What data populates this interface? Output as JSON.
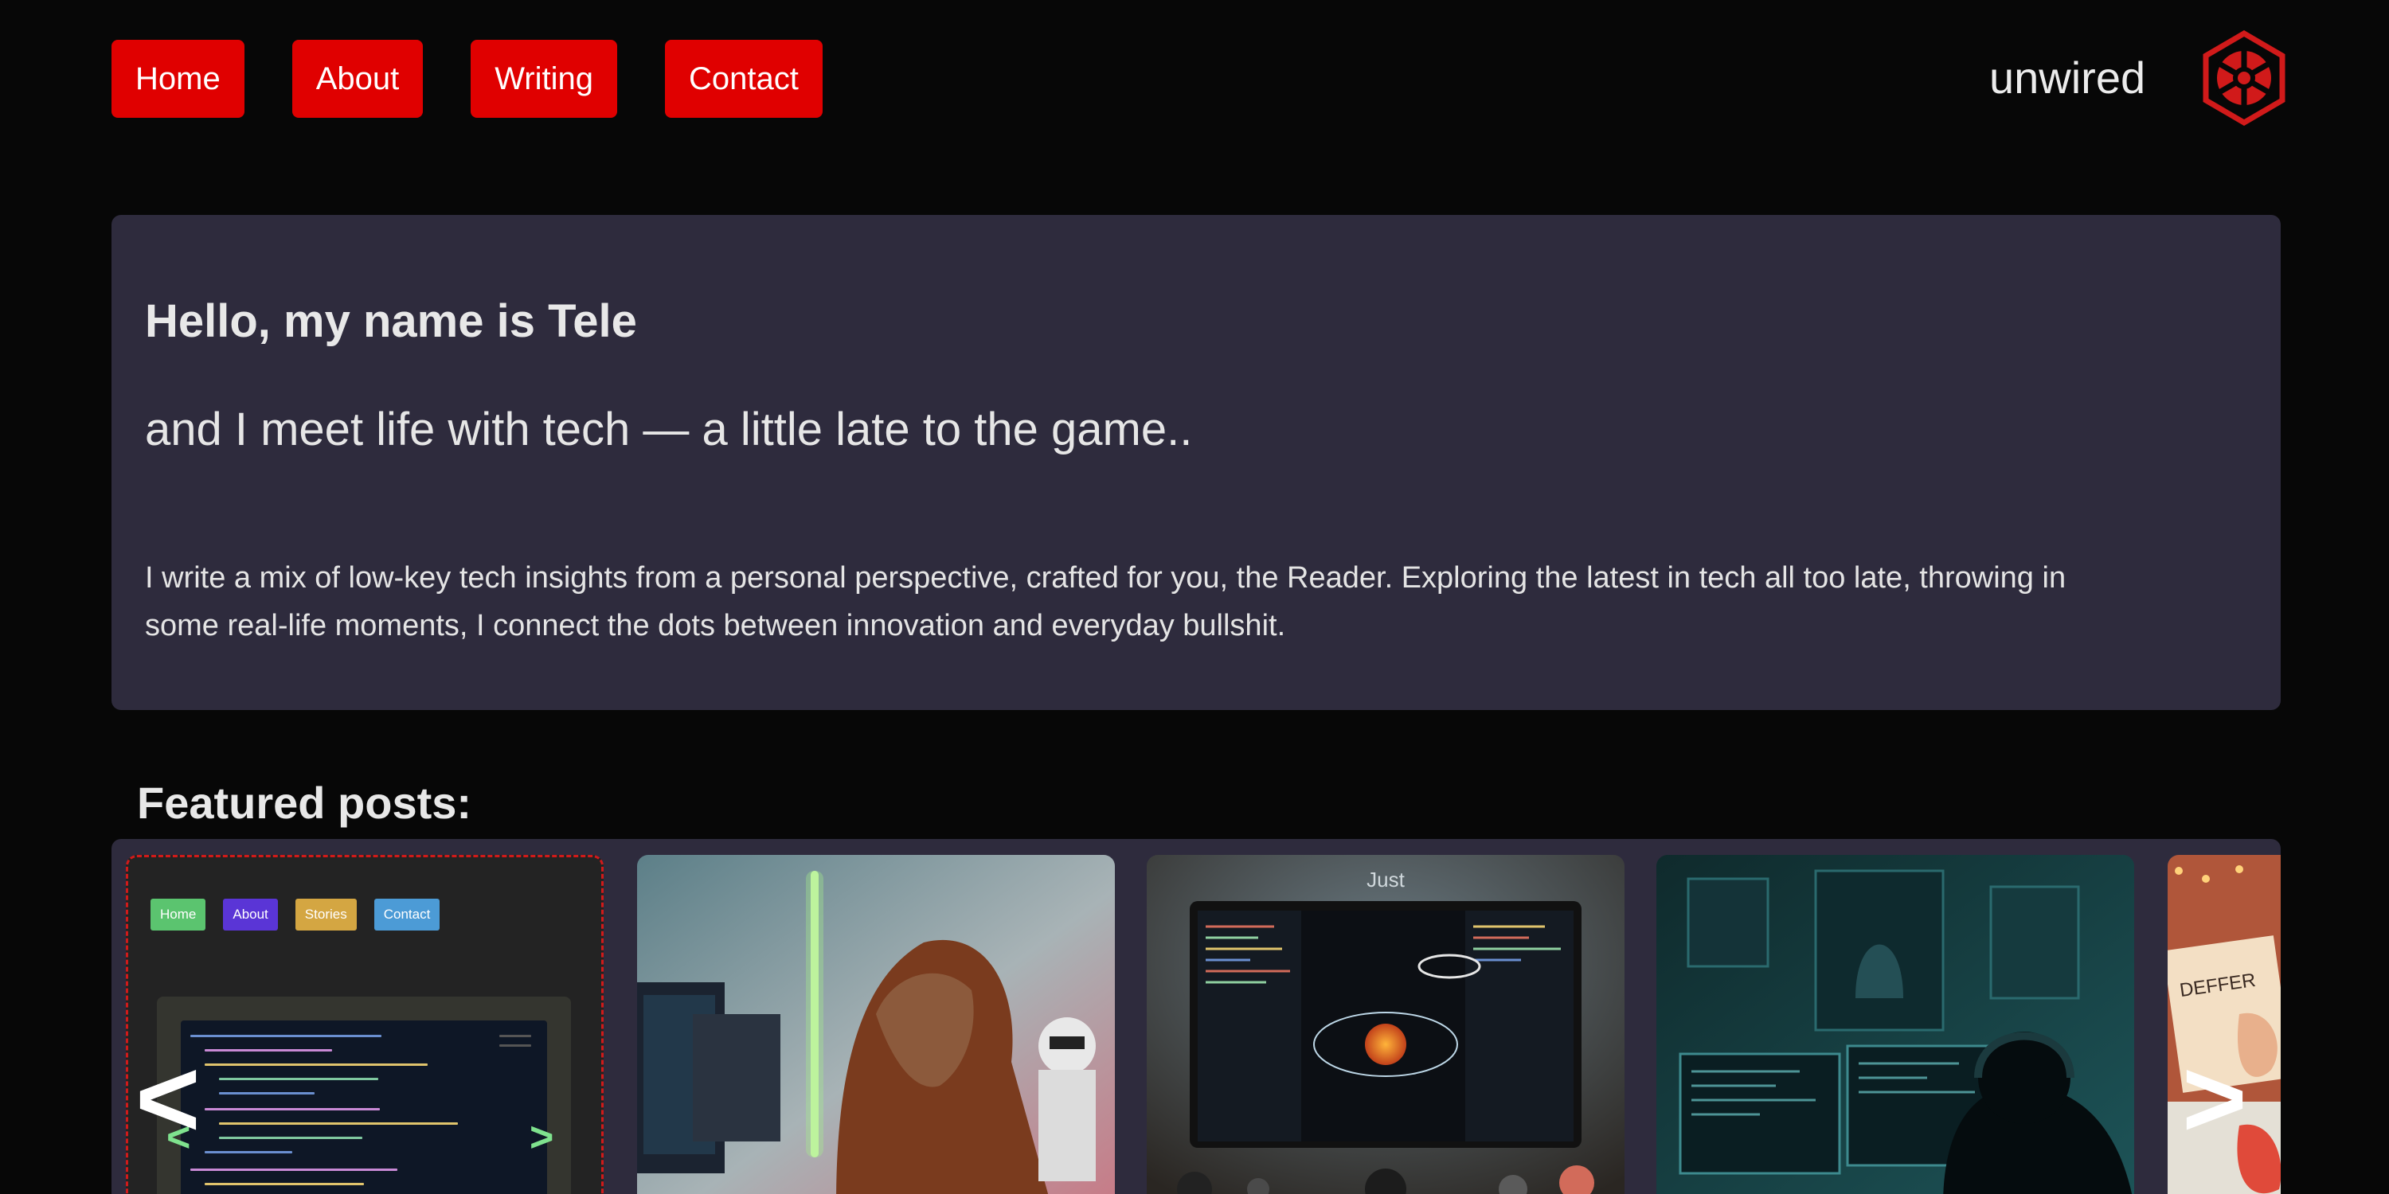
{
  "nav": {
    "items": [
      {
        "label": "Home"
      },
      {
        "label": "About"
      },
      {
        "label": "Writing"
      },
      {
        "label": "Contact"
      }
    ]
  },
  "brand": {
    "name": "unwired",
    "logo_icon": "sith-empire-emblem-icon"
  },
  "hero": {
    "title": "Hello, my name is Tele",
    "subtitle": "and I meet life with tech — a little late to the game..",
    "body": "I write a mix of low-key tech insights from a personal perspective, crafted for you, the Reader. Exploring the latest in tech all too late, throwing in some real-life moments, I connect the dots between innovation and everyday bullshit."
  },
  "featured": {
    "heading": "Featured posts:",
    "prev_arrow": "<",
    "next_arrow": ">",
    "first_card": {
      "mini_nav": [
        "Home",
        "About",
        "Stories",
        "Contact"
      ],
      "small_prev": "<",
      "small_next": ">"
    },
    "card_images": [
      "website-preview-thumbnail",
      "hooded-jedi-coding-thumbnail",
      "just-cli-monitor-thumbnail",
      "hacker-dark-room-thumbnail",
      "sticky-notes-desk-thumbnail"
    ],
    "sticky_note_text": "DEFFER"
  },
  "colors": {
    "background": "#070707",
    "nav_button": "#e00000",
    "panel": "#2e2b3d",
    "accent_red": "#d11a1a"
  }
}
